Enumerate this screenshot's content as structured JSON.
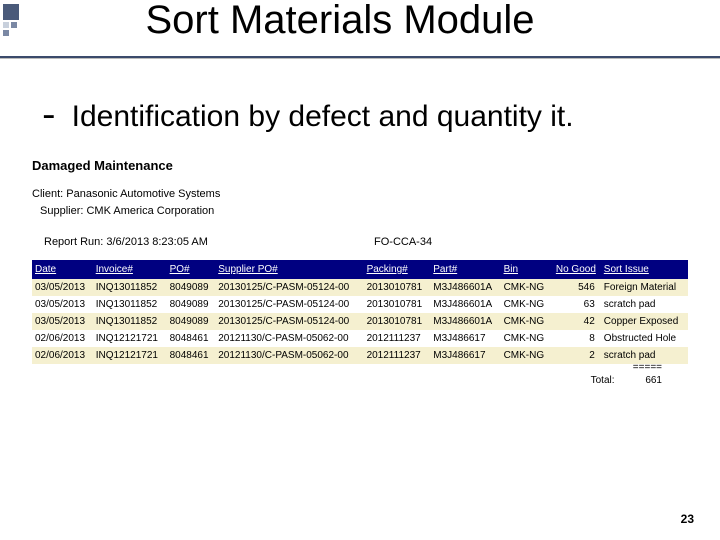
{
  "title": "Sort Materials  Module",
  "subtitle_dash": "-",
  "subtitle": "Identification by defect and quantity it.",
  "section_heading": "Damaged Maintenance",
  "client_label": "Client:",
  "client_value": "Panasonic Automotive Systems",
  "supplier_label": "Supplier:",
  "supplier_value": "CMK America Corporation",
  "report_run_label": "Report Run:",
  "report_run_value": "3/6/2013 8:23:05 AM",
  "form_id": "FO-CCA-34",
  "columns": {
    "date": "Date",
    "invoice": "Invoice#",
    "po": "PO#",
    "supplier_po": "Supplier PO#",
    "packing": "Packing#",
    "part": "Part#",
    "bin": "Bin",
    "nogood": "No Good",
    "issue": "Sort Issue"
  },
  "rows": [
    {
      "date": "03/05/2013",
      "invoice": "INQ13011852",
      "po": "8049089",
      "supplier_po": "20130125/C-PASM-05124-00",
      "packing": "2013010781",
      "part": "M3J486601A",
      "bin": "CMK-NG",
      "nogood": "546",
      "issue": "Foreign Material"
    },
    {
      "date": "03/05/2013",
      "invoice": "INQ13011852",
      "po": "8049089",
      "supplier_po": "20130125/C-PASM-05124-00",
      "packing": "2013010781",
      "part": "M3J486601A",
      "bin": "CMK-NG",
      "nogood": "63",
      "issue": "scratch pad"
    },
    {
      "date": "03/05/2013",
      "invoice": "INQ13011852",
      "po": "8049089",
      "supplier_po": "20130125/C-PASM-05124-00",
      "packing": "2013010781",
      "part": "M3J486601A",
      "bin": "CMK-NG",
      "nogood": "42",
      "issue": "Copper Exposed"
    },
    {
      "date": "02/06/2013",
      "invoice": "INQ12121721",
      "po": "8048461",
      "supplier_po": "20121130/C-PASM-05062-00",
      "packing": "2012111237",
      "part": "M3J486617",
      "bin": "CMK-NG",
      "nogood": "8",
      "issue": "Obstructed Hole"
    },
    {
      "date": "02/06/2013",
      "invoice": "INQ12121721",
      "po": "8048461",
      "supplier_po": "20121130/C-PASM-05062-00",
      "packing": "2012111237",
      "part": "M3J486617",
      "bin": "CMK-NG",
      "nogood": "2",
      "issue": "scratch pad"
    }
  ],
  "total_separator": "=====",
  "total_label": "Total:",
  "total_value": "661",
  "page_number": "23"
}
